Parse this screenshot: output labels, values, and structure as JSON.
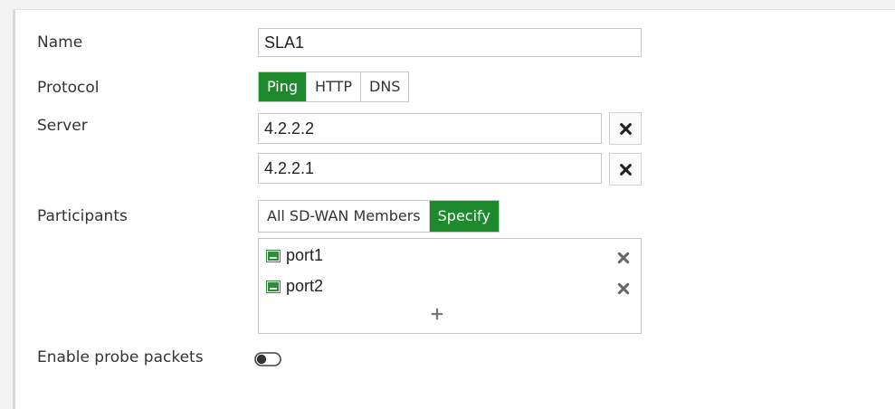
{
  "form": {
    "name": {
      "label": "Name",
      "value": "SLA1"
    },
    "protocol": {
      "label": "Protocol",
      "options": [
        "Ping",
        "HTTP",
        "DNS"
      ],
      "selected": "Ping"
    },
    "server": {
      "label": "Server",
      "values": [
        "4.2.2.2",
        "4.2.2.1"
      ]
    },
    "participants": {
      "label": "Participants",
      "options": [
        "All SD-WAN Members",
        "Specify"
      ],
      "selected": "Specify",
      "items": [
        "port1",
        "port2"
      ]
    },
    "probe": {
      "label": "Enable probe packets",
      "enabled": false
    }
  },
  "colors": {
    "accent": "#1e8a2e",
    "port_icon": "#2e8b3a"
  },
  "icons": {
    "remove": "close-icon",
    "add": "plus-icon",
    "port": "network-port-icon",
    "toggle": "toggle-switch-icon"
  }
}
